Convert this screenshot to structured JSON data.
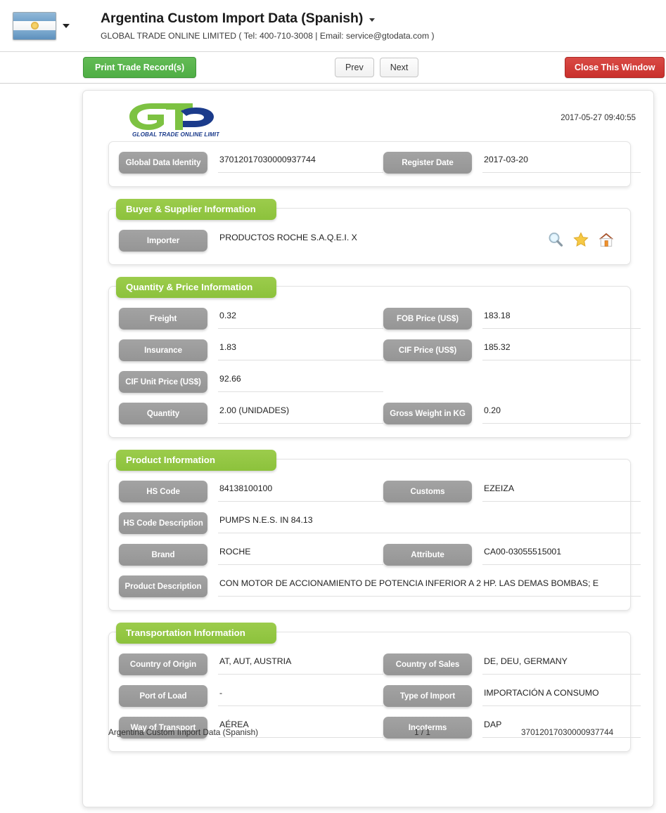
{
  "header": {
    "flag_icon": "argentina-flag-icon",
    "flag_dropdown_icon": "chevron-down-icon",
    "title": "Argentina Custom Import Data (Spanish)",
    "title_dropdown_icon": "chevron-down-icon",
    "subtitle": "GLOBAL TRADE ONLINE LIMITED ( Tel: 400-710-3008 | Email: service@gtodata.com )"
  },
  "toolbar": {
    "print_label": "Print Trade Record(s)",
    "prev_label": "Prev",
    "next_label": "Next",
    "close_label": "Close This Window",
    "green": "#4fae45",
    "red": "#c9302c"
  },
  "document": {
    "logo_text": "GTO",
    "logo_tagline": "GLOBAL TRADE  ONLINE LIMITED",
    "timestamp": "2017-05-27 09:40:55",
    "identity": {
      "label_identity": "Global Data Identity",
      "value_identity": "37012017030000937744",
      "label_register": "Register Date",
      "value_register": "2017-03-20"
    },
    "sections": [
      {
        "title": "Buyer & Supplier Information",
        "rows": [
          {
            "left_label": "Importer",
            "left_value": "PRODUCTOS ROCHE S.A.Q.E.I. X"
          }
        ],
        "icons": [
          {
            "name": "search-icon",
            "title": "Search"
          },
          {
            "name": "star-icon",
            "title": "Favorite"
          },
          {
            "name": "home-icon",
            "title": "Home"
          }
        ]
      },
      {
        "title": "Quantity & Price Information",
        "rows": [
          {
            "left_label": "Freight",
            "left_value": "0.32",
            "right_label": "FOB Price (US$)",
            "right_value": "183.18"
          },
          {
            "left_label": "Insurance",
            "left_value": "1.83",
            "right_label": "CIF Price (US$)",
            "right_value": "185.32"
          },
          {
            "left_label": "CIF Unit Price (US$)",
            "left_value": "92.66"
          },
          {
            "left_label": "Quantity",
            "left_value": "2.00 (UNIDADES)",
            "right_label": "Gross Weight in KG",
            "right_value": "0.20"
          }
        ]
      },
      {
        "title": "Product Information",
        "rows": [
          {
            "left_label": "HS Code",
            "left_value": "84138100100",
            "right_label": "Customs",
            "right_value": "EZEIZA"
          },
          {
            "left_label": "HS Code Description",
            "left_value": "PUMPS N.E.S. IN 84.13"
          },
          {
            "left_label": "Brand",
            "left_value": "ROCHE",
            "right_label": "Attribute",
            "right_value": "CA00-03055515001"
          },
          {
            "left_label": "Product Description",
            "left_value": "CON MOTOR DE ACCIONAMIENTO DE POTENCIA INFERIOR A 2 HP. LAS DEMAS BOMBAS; E"
          }
        ]
      },
      {
        "title": "Transportation Information",
        "rows": [
          {
            "left_label": "Country of Origin",
            "left_value": "AT, AUT, AUSTRIA",
            "right_label": "Country of Sales",
            "right_value": "DE, DEU, GERMANY"
          },
          {
            "left_label": "Port of Load",
            "left_value": "-",
            "right_label": "Type of Import",
            "right_value": "IMPORTACIÓN A CONSUMO"
          },
          {
            "left_label": "Way of Transport",
            "left_value": "AÉREA",
            "right_label": "Incoterms",
            "right_value": "DAP"
          }
        ]
      }
    ],
    "footer": {
      "left": "Argentina Custom Import Data (Spanish)",
      "page": "1 / 1",
      "right": "37012017030000937744"
    }
  },
  "colors": {
    "section_green": "#8cc23c",
    "label_grey": "#959595",
    "logo_green": "#7dc242",
    "logo_blue": "#1b3b8b"
  }
}
